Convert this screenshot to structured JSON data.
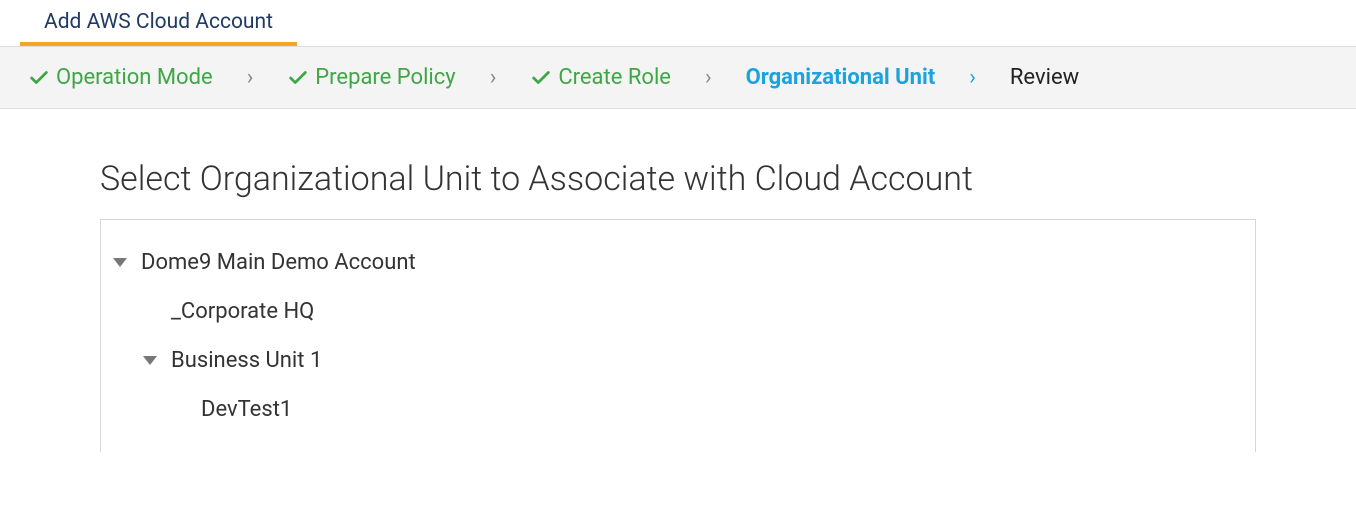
{
  "tab": {
    "title": "Add AWS Cloud Account"
  },
  "steps": {
    "operation_mode": "Operation Mode",
    "prepare_policy": "Prepare Policy",
    "create_role": "Create Role",
    "organizational_unit": "Organizational Unit",
    "review": "Review"
  },
  "main": {
    "title": "Select Organizational Unit to Associate with Cloud Account"
  },
  "tree": {
    "root": "Dome9 Main Demo Account",
    "corporate_hq": "_Corporate HQ",
    "bu1": "Business Unit 1",
    "devtest1": "DevTest1"
  }
}
